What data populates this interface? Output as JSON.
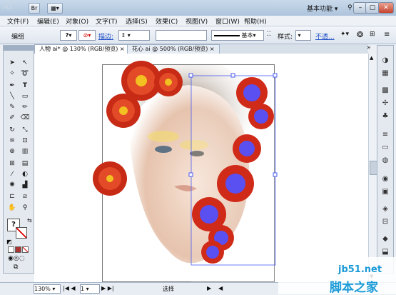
{
  "app": {
    "logo": "Ai",
    "workspace": "基本功能"
  },
  "menu": [
    "文件(F)",
    "编辑(E)",
    "对象(O)",
    "文字(T)",
    "选择(S)",
    "效果(C)",
    "视图(V)",
    "窗口(W)",
    "帮助(H)"
  ],
  "control": {
    "group_label": "编组",
    "fill": "?",
    "stroke_label": "描边:",
    "stroke_style": "基本",
    "style_label": "样式:",
    "opacity_label": "不透..."
  },
  "tabs": [
    {
      "label": "人物 ai* @ 130% (RGB/预览)",
      "close": "×",
      "active": true
    },
    {
      "label": "花心 ai @ 500% (RGB/预览)",
      "close": "×",
      "active": false
    }
  ],
  "status": {
    "zoom": "130%",
    "page": "1",
    "tool": "选择"
  },
  "watermark": {
    "site": "jb51.net",
    "name": "脚本之家"
  },
  "colors": {
    "flower": "#d8311b",
    "flower_center": "#5a4ff0",
    "accent": "#1f4ec9"
  }
}
